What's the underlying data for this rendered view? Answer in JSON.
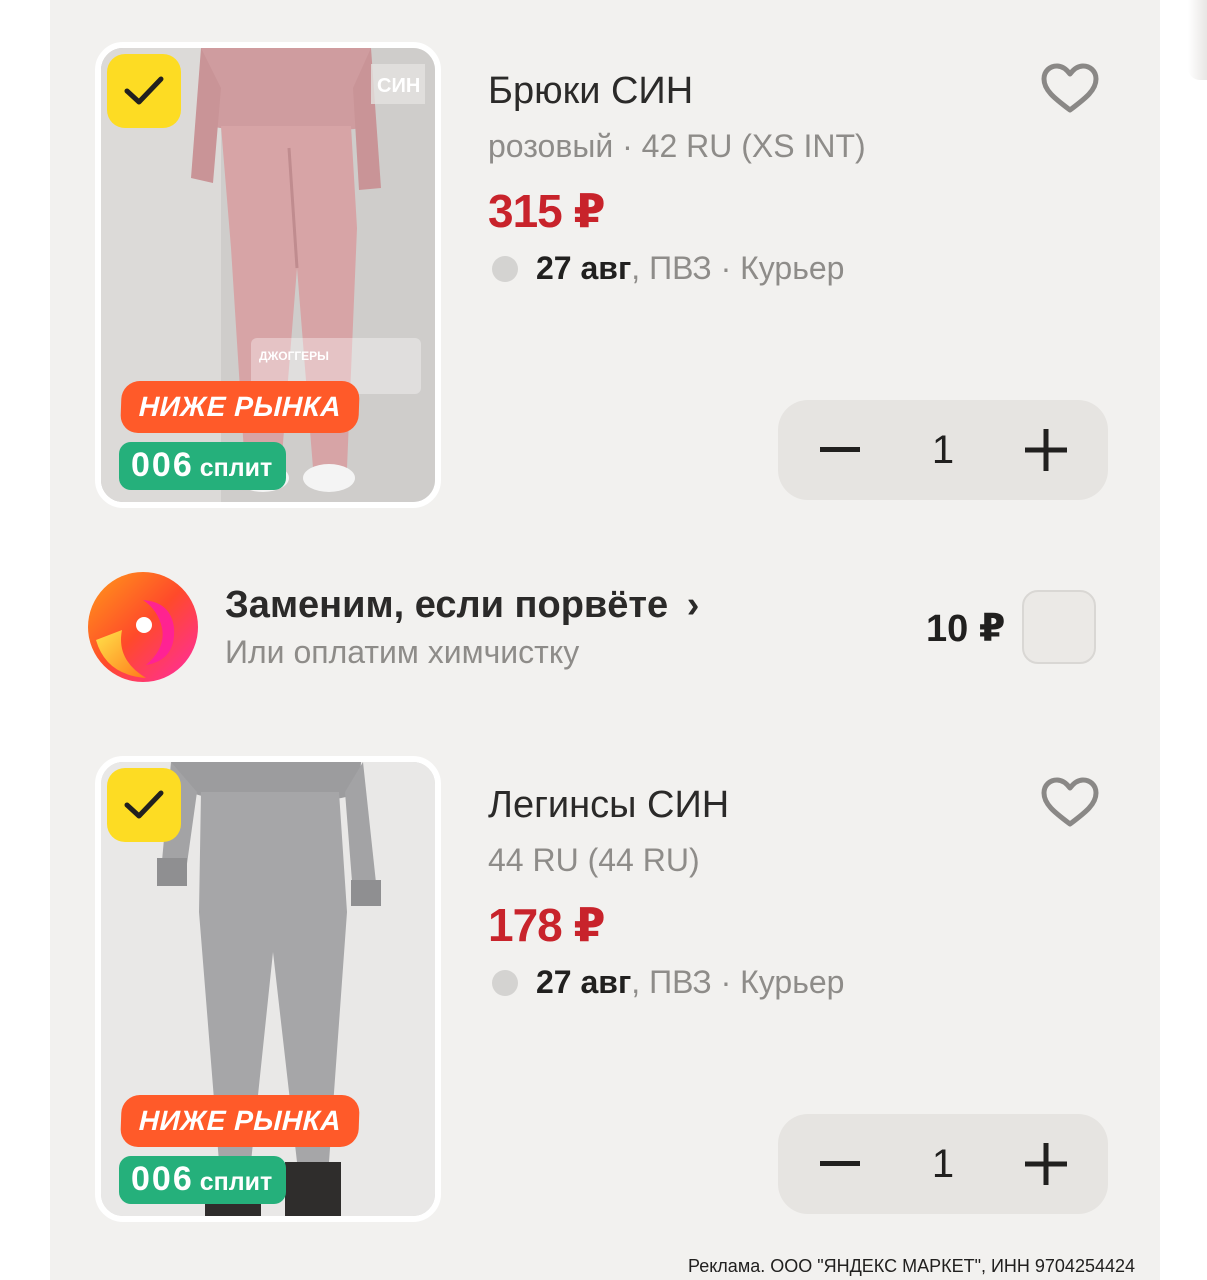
{
  "items": [
    {
      "title": "Брюки СИН",
      "variant": "розовый · 42 RU (XS INT)",
      "price": "315 ₽",
      "delivery_date": "27 авг",
      "delivery_rest": ", ПВЗ · Курьер",
      "badge_market": "НИЖЕ РЫНКА",
      "split_number": "006",
      "split_label": "сплит",
      "quantity": "1",
      "photo_brand_text": "СИН",
      "photo_caption": "ДЖОГГЕРЫ",
      "photo_color": "#d7a4a6"
    },
    {
      "title": "Легинсы СИН",
      "variant": "44 RU (44 RU)",
      "price": "178 ₽",
      "delivery_date": "27 авг",
      "delivery_rest": ", ПВЗ · Курьер",
      "badge_market": "НИЖЕ РЫНКА",
      "split_number": "006",
      "split_label": "сплит",
      "quantity": "1",
      "photo_color": "#a6a6a8"
    }
  ],
  "service": {
    "name": "Заменим, если порвёте",
    "chevron": "›",
    "subtitle": "Или оплатим химчистку",
    "price": "10 ₽"
  },
  "legal": "Реклама. ООО \"ЯНДЕКС МАРКЕТ\", ИНН 9704254424",
  "colors": {
    "price": "#c8232b",
    "check_bg": "#fddc23",
    "badge_market_bg": "#ff5a29",
    "badge_split_bg": "#25b07b",
    "panel_bg": "#f2f1ef"
  }
}
